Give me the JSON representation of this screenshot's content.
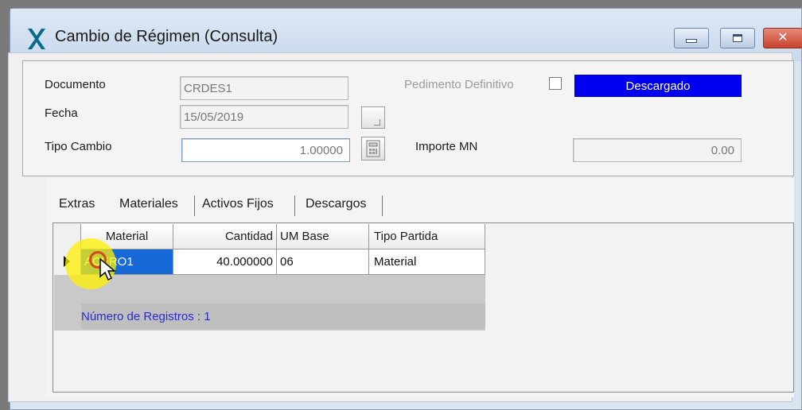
{
  "window": {
    "title": "Cambio de Régimen (Consulta)",
    "buttons": {
      "minimize": "minimize-icon",
      "maximize": "maximize-icon",
      "close": "✕"
    }
  },
  "form": {
    "documento": {
      "label": "Documento",
      "value": "CRDES1"
    },
    "fecha": {
      "label": "Fecha",
      "value": "15/05/2019"
    },
    "tipo_cambio": {
      "label": "Tipo Cambio",
      "value": "1.00000"
    },
    "pedimento_definitivo": {
      "label": "Pedimento Definitivo",
      "checked": false
    },
    "status": {
      "text": "Descargado",
      "color": "#0000f0"
    },
    "importe_mn": {
      "label": "Importe MN",
      "value": "0.00"
    }
  },
  "tabs": [
    {
      "label": "Extras",
      "active": false
    },
    {
      "label": "Materiales",
      "active": true
    },
    {
      "label": "Activos Fijos",
      "active": false
    },
    {
      "label": "Descargos",
      "active": false
    }
  ],
  "grid": {
    "columns": [
      "Material",
      "Cantidad",
      "UM Base",
      "Tipo Partida"
    ],
    "rows": [
      {
        "material": "ACERO1",
        "cantidad": "40.000000",
        "um_base": "06",
        "tipo_partida": "Material"
      }
    ],
    "records_text": "Número de Registros : 1"
  },
  "colors": {
    "selection": "#1769d8",
    "records_text": "#2a2ad2",
    "cursor_highlight": "#fff000"
  }
}
